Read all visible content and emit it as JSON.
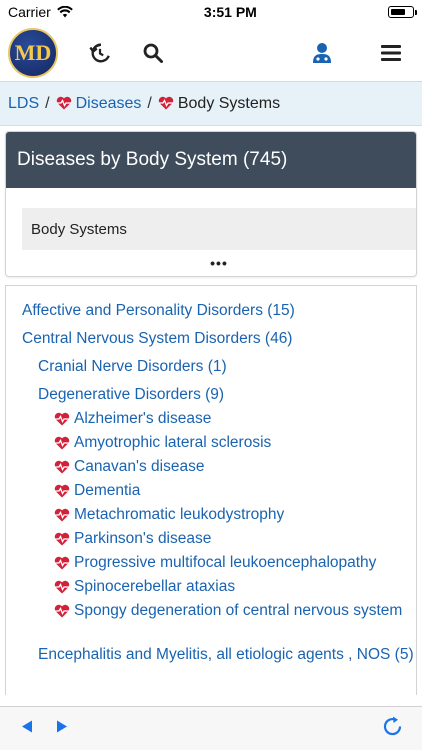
{
  "status_bar": {
    "carrier": "Carrier",
    "time": "3:51 PM"
  },
  "app_bar": {
    "logo_text": "MD"
  },
  "breadcrumb": {
    "root": "LDS",
    "separator": "/",
    "diseases": "Diseases",
    "current": "Body Systems"
  },
  "card": {
    "title": "Diseases by Body System (745)",
    "selected": "Body Systems",
    "more": "•••"
  },
  "list": {
    "affective": "Affective and Personality Disorders (15)",
    "cns": "Central Nervous System Disorders (46)",
    "cranial": "Cranial Nerve Disorders (1)",
    "degenerative": "Degenerative Disorders (9)",
    "diseases": [
      "Alzheimer's disease",
      "Amyotrophic lateral sclerosis",
      "Canavan's disease",
      "Dementia",
      "Metachromatic leukodystrophy",
      "Parkinson's disease",
      "Progressive multifocal leukoencephalopathy",
      "Spinocerebellar ataxias",
      "Spongy degeneration of central nervous system"
    ],
    "encephalitis": "Encephalitis and Myelitis, all etiologic agents , NOS (5)"
  },
  "colors": {
    "link": "#1a63b0",
    "header": "#3f4c5c",
    "heart": "#d0233b",
    "breadcrumb_bg": "#e6f1f8"
  },
  "icons": [
    "wifi-icon",
    "battery-icon",
    "history-icon",
    "search-icon",
    "doctor-icon",
    "menu-icon",
    "heart-pulse-icon",
    "back-arrow-icon",
    "forward-arrow-icon",
    "refresh-icon"
  ]
}
